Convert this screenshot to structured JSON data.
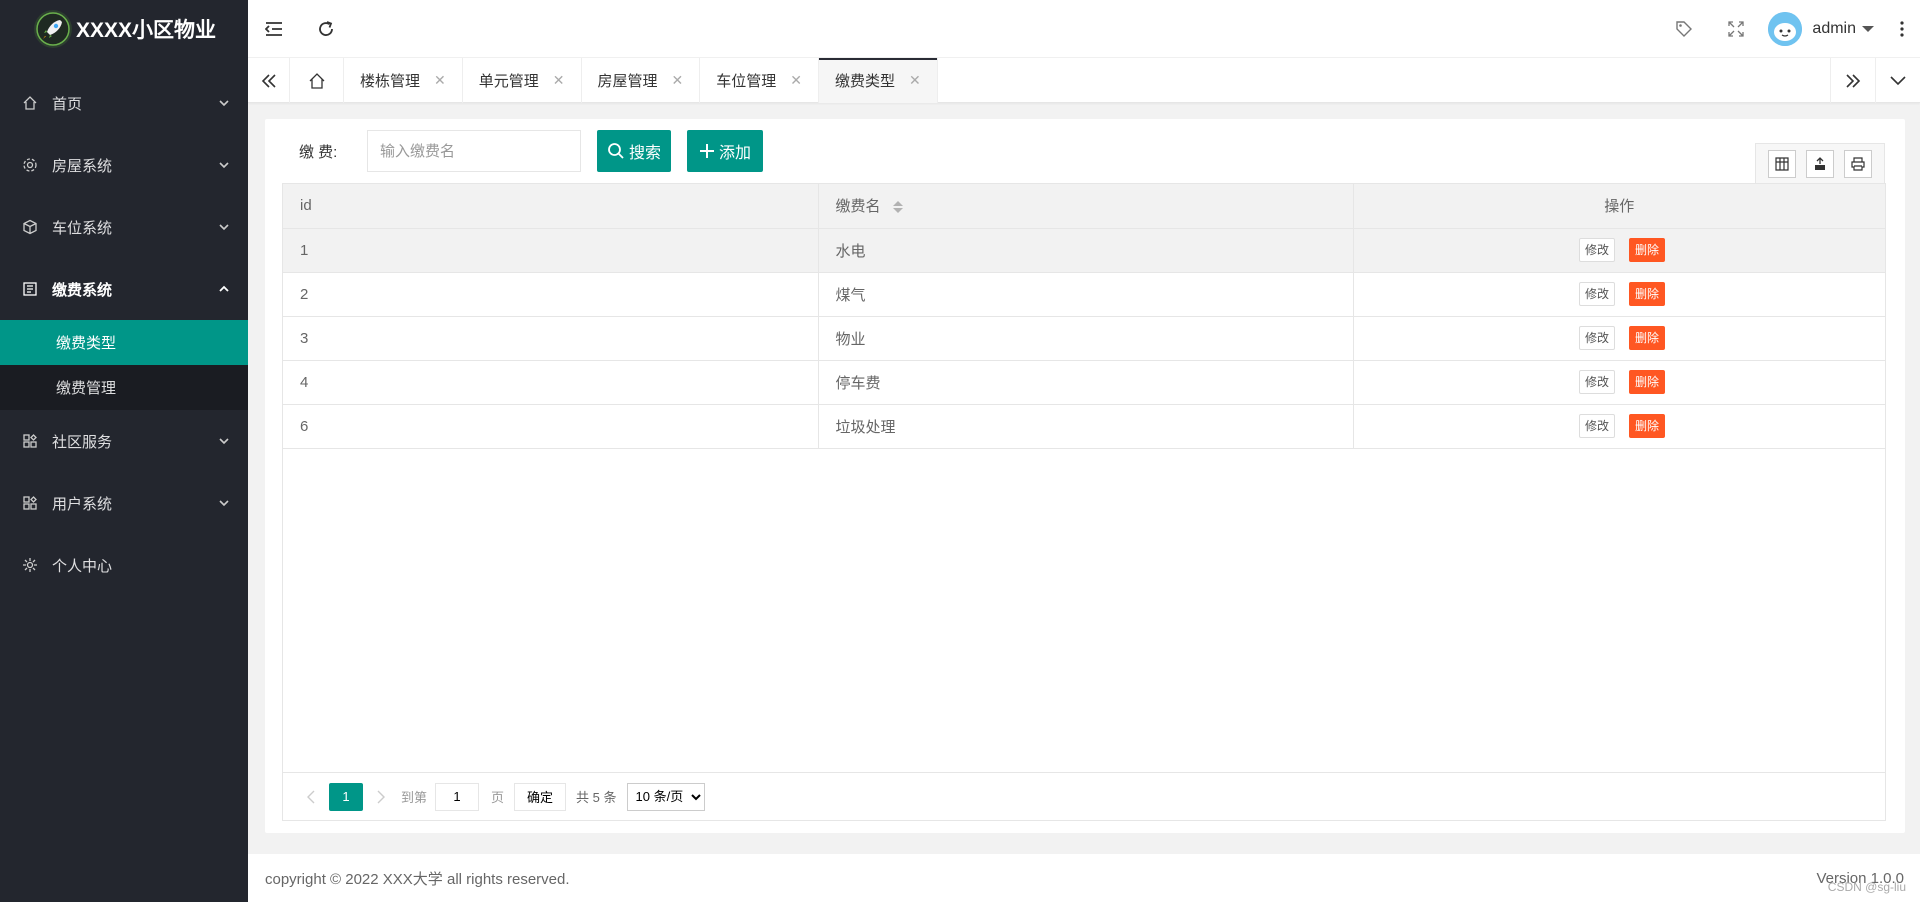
{
  "app": {
    "title": "XXXX小区物业"
  },
  "sidebar": {
    "items": [
      {
        "label": "首页",
        "icon": "home-icon"
      },
      {
        "label": "房屋系统",
        "icon": "gear-icon"
      },
      {
        "label": "车位系统",
        "icon": "cube-icon"
      },
      {
        "label": "缴费系统",
        "icon": "receipt-icon"
      },
      {
        "label": "社区服务",
        "icon": "apps-icon"
      },
      {
        "label": "用户系统",
        "icon": "apps-icon"
      },
      {
        "label": "个人中心",
        "icon": "settings-icon"
      }
    ],
    "sub_items": [
      {
        "label": "缴费类型"
      },
      {
        "label": "缴费管理"
      }
    ]
  },
  "header": {
    "user": "admin"
  },
  "tabs": [
    {
      "label": "楼栋管理"
    },
    {
      "label": "单元管理"
    },
    {
      "label": "房屋管理"
    },
    {
      "label": "车位管理"
    },
    {
      "label": "缴费类型"
    }
  ],
  "search": {
    "label": "缴 费:",
    "placeholder": "输入缴费名",
    "search_label": "搜索",
    "add_label": "添加"
  },
  "table": {
    "headers": [
      "id",
      "缴费名",
      "操作"
    ],
    "rows": [
      {
        "id": "1",
        "name": "水电"
      },
      {
        "id": "2",
        "name": "煤气"
      },
      {
        "id": "3",
        "name": "物业"
      },
      {
        "id": "4",
        "name": "停车费"
      },
      {
        "id": "6",
        "name": "垃圾处理"
      }
    ],
    "edit_label": "修改",
    "delete_label": "删除"
  },
  "pager": {
    "current": "1",
    "goto_label": "到第",
    "page_input": "1",
    "page_unit": "页",
    "confirm_label": "确定",
    "total": "共 5 条",
    "page_size": "10 条/页"
  },
  "footer": {
    "copyright": "copyright © 2022 XXX大学 all rights reserved.",
    "version": "Version 1.0.0"
  },
  "watermark": "CSDN @sg-liu",
  "colors": {
    "accent": "#009688",
    "danger": "#ff5722",
    "sidebar": "#23262e"
  }
}
